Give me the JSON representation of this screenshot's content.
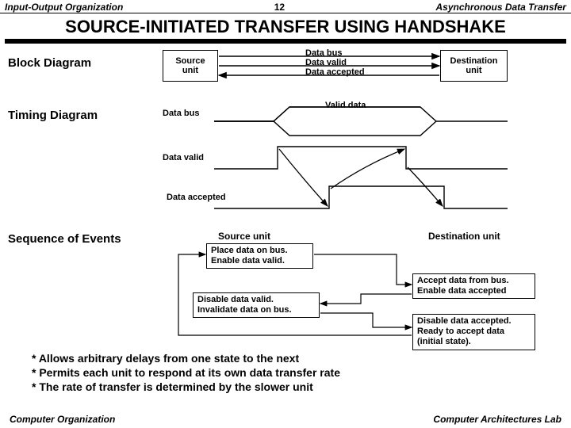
{
  "header": {
    "left": "Input-Output Organization",
    "center": "12",
    "right": "Asynchronous Data Transfer"
  },
  "title": "SOURCE-INITIATED  TRANSFER  USING  HANDSHAKE",
  "sections": {
    "block": "Block Diagram",
    "timing": "Timing Diagram",
    "sequence": "Sequence of Events"
  },
  "block": {
    "source": "Source\nunit",
    "dest": "Destination\nunit",
    "sig1": "Data bus",
    "sig2": "Data valid",
    "sig3": "Data accepted"
  },
  "timing": {
    "databus": "Data bus",
    "validdata": "Valid data",
    "datavalid": "Data valid",
    "dataaccepted": "Data accepted"
  },
  "events": {
    "sourceHead": "Source unit",
    "destHead": "Destination unit",
    "b1a": "Place data on bus.",
    "b1b": "Enable data valid.",
    "b2a": "Accept data from bus.",
    "b2b": "Enable data accepted",
    "b3a": "Disable data valid.",
    "b3b": "Invalidate data on bus.",
    "b4a": "Disable data accepted.",
    "b4b": "Ready to accept data",
    "b4c": "(initial state)."
  },
  "bullets": {
    "l1": "* Allows arbitrary delays from one state to the next",
    "l2": "* Permits each unit to respond at its own data transfer rate",
    "l3": "* The rate of transfer is determined by the slower unit"
  },
  "footer": {
    "left": "Computer Organization",
    "right": "Computer Architectures Lab"
  }
}
